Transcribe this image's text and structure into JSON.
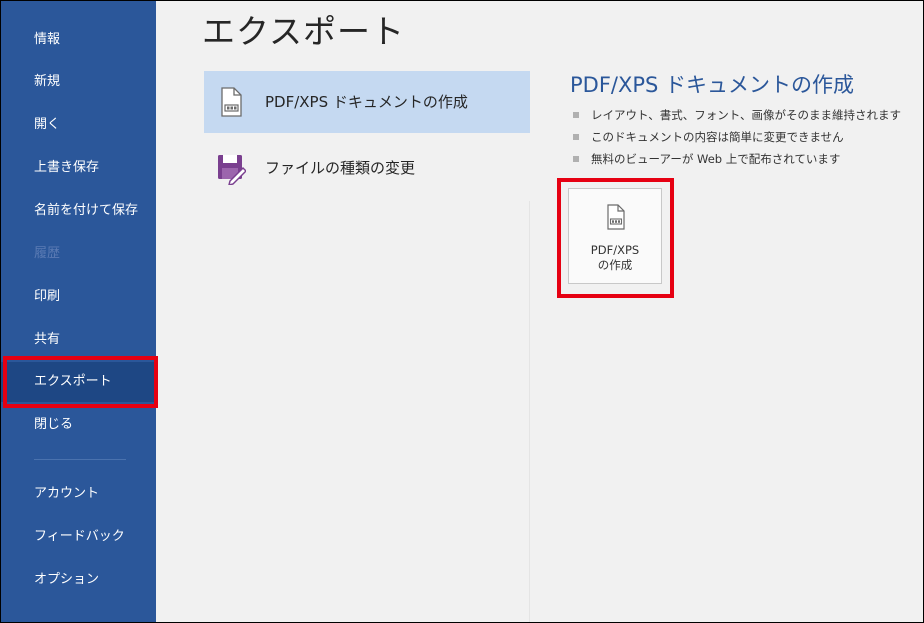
{
  "sidebar": {
    "items": [
      {
        "label": "情報",
        "state": "normal"
      },
      {
        "label": "新規",
        "state": "normal"
      },
      {
        "label": "開く",
        "state": "normal"
      },
      {
        "label": "上書き保存",
        "state": "normal"
      },
      {
        "label": "名前を付けて保存",
        "state": "normal"
      },
      {
        "label": "履歴",
        "state": "disabled"
      },
      {
        "label": "印刷",
        "state": "normal"
      },
      {
        "label": "共有",
        "state": "normal"
      },
      {
        "label": "エクスポート",
        "state": "selected"
      },
      {
        "label": "閉じる",
        "state": "normal"
      },
      {
        "label": "アカウント",
        "state": "normal"
      },
      {
        "label": "フィードバック",
        "state": "normal"
      },
      {
        "label": "オプション",
        "state": "normal"
      }
    ]
  },
  "main": {
    "title": "エクスポート",
    "options": [
      {
        "label": "PDF/XPS ドキュメントの作成",
        "icon": "pdf-document-icon",
        "selected": true
      },
      {
        "label": "ファイルの種類の変更",
        "icon": "change-file-type-icon",
        "selected": false
      }
    ]
  },
  "detail": {
    "title": "PDF/XPS ドキュメントの作成",
    "bullets": [
      "レイアウト、書式、フォント、画像がそのまま維持されます",
      "このドキュメントの内容は簡単に変更できません",
      "無料のビューアーが Web 上で配布されています"
    ],
    "create_button": {
      "line1": "PDF/XPS",
      "line2": "の作成",
      "icon": "pdf-document-icon"
    }
  },
  "colors": {
    "sidebar": "#2b579a",
    "sidebar_selected": "#1e4784",
    "selected_option": "#c5d9f1",
    "highlight": "#e60012",
    "accent_text": "#2b579a"
  }
}
